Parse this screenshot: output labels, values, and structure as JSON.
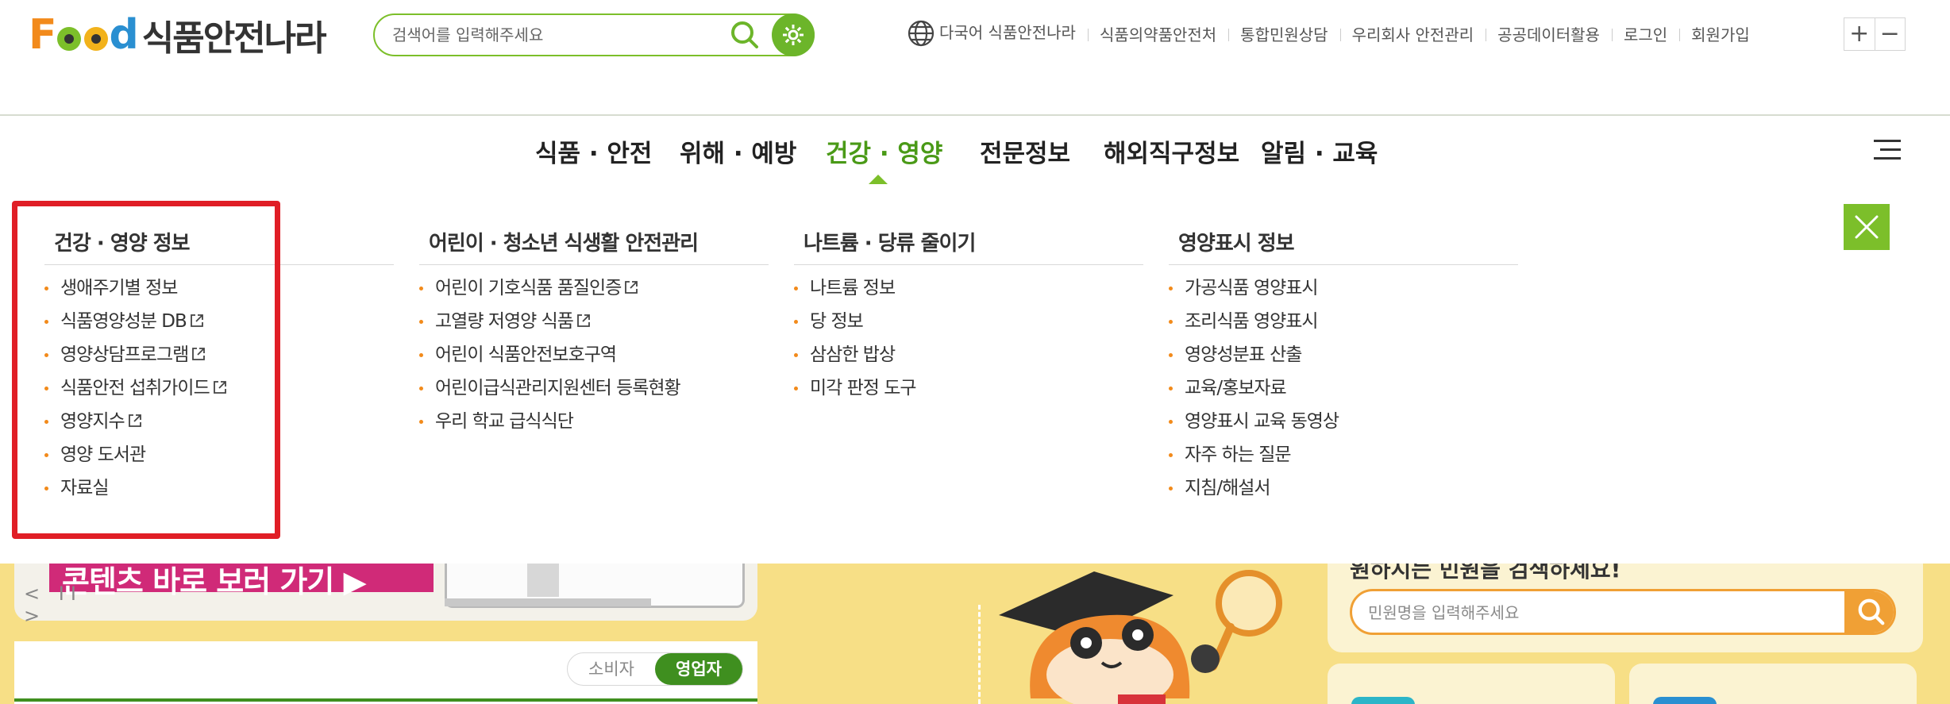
{
  "header": {
    "logo_lettering": "Food식품안전나라",
    "logo_korean": "식품안전나라",
    "search": {
      "placeholder": "검색어를 입력해주세요",
      "value": ""
    },
    "utility_links": [
      {
        "label": "다국어 식품안전나라",
        "icon": "globe-icon"
      },
      {
        "label": "식품의약품안전처"
      },
      {
        "label": "통합민원상담"
      },
      {
        "label": "우리회사 안전관리"
      },
      {
        "label": "공공데이터활용"
      },
      {
        "label": "로그인"
      },
      {
        "label": "회원가입"
      }
    ],
    "zoom": {
      "in_label": "+",
      "out_label": "−"
    }
  },
  "gnb": {
    "items": [
      {
        "label": "식품 · 안전",
        "active": false
      },
      {
        "label": "위해 · 예방",
        "active": false
      },
      {
        "label": "건강 · 영양",
        "active": true
      },
      {
        "label": "전문정보",
        "active": false
      },
      {
        "label": "해외직구정보",
        "active": false
      },
      {
        "label": "알림 · 교육",
        "active": false
      }
    ]
  },
  "mega_menu": {
    "columns": [
      {
        "title": "건강 · 영양 정보",
        "items": [
          {
            "label": "생애주기별 정보",
            "external": false
          },
          {
            "label": "식품영양성분 DB",
            "external": true
          },
          {
            "label": "영양상담프로그램",
            "external": true
          },
          {
            "label": "식품안전 섭취가이드",
            "external": true
          },
          {
            "label": "영양지수",
            "external": true
          },
          {
            "label": "영양 도서관",
            "external": false
          },
          {
            "label": "자료실",
            "external": false
          }
        ]
      },
      {
        "title": "어린이 · 청소년 식생활 안전관리",
        "items": [
          {
            "label": "어린이 기호식품 품질인증",
            "external": true
          },
          {
            "label": "고열량 저영양 식품",
            "external": true
          },
          {
            "label": "어린이 식품안전보호구역",
            "external": false
          },
          {
            "label": "어린이급식관리지원센터 등록현황",
            "external": false
          },
          {
            "label": "우리 학교 급식식단",
            "external": false
          }
        ]
      },
      {
        "title": "나트륨 · 당류 줄이기",
        "items": [
          {
            "label": "나트륨 정보",
            "external": false
          },
          {
            "label": "당 정보",
            "external": false
          },
          {
            "label": "삼삼한 밥상",
            "external": false
          },
          {
            "label": "미각 판정 도구",
            "external": false
          }
        ]
      },
      {
        "title": "영양표시 정보",
        "items": [
          {
            "label": "가공식품 영양표시",
            "external": false
          },
          {
            "label": "조리식품 영양표시",
            "external": false
          },
          {
            "label": "영양성분표 산출",
            "external": false
          },
          {
            "label": "교육/홍보자료",
            "external": false
          },
          {
            "label": "영양표시 교육 동영상",
            "external": false
          },
          {
            "label": "자주 하는 질문",
            "external": false
          },
          {
            "label": "지침/해설서",
            "external": false
          }
        ]
      }
    ]
  },
  "background": {
    "banner_text": "콘텐츠 바로 보러 가기 ▶",
    "slider_controls": "< II >",
    "tabs": {
      "consumer": "소비자",
      "business": "영업자",
      "selected": "영업자"
    },
    "minwon": {
      "title": "원하시는 민원을 검색하세요!",
      "placeholder": "민원명을 입력해주세요"
    }
  },
  "colors": {
    "brand_green": "#7cbf2a",
    "active_green": "#4a9a17",
    "bullet_orange": "#f28a1b",
    "highlight_red": "#e01e26",
    "page_yellow": "#f7df86",
    "tab_green": "#3f8f1f",
    "minwon_orange": "#f0a035"
  }
}
